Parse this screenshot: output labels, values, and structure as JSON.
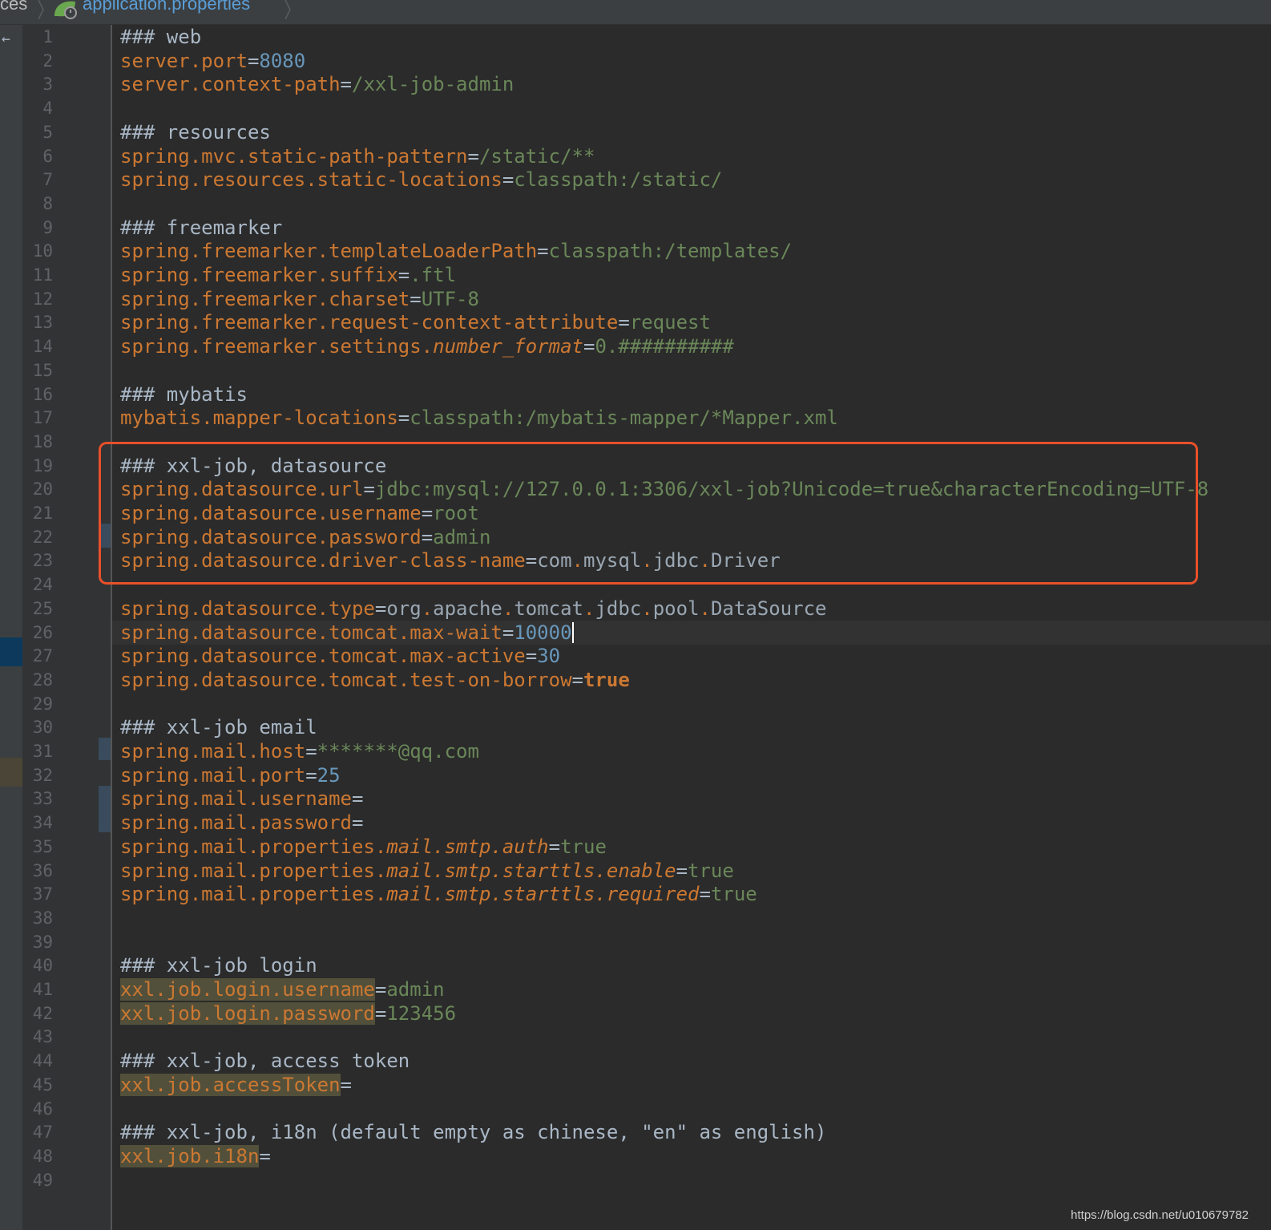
{
  "breadcrumb": {
    "parent": "ces",
    "file": "application.properties",
    "file_color": "#5a9ed8"
  },
  "editor": {
    "line_count": 49,
    "caret_line": 26,
    "highlight_box_color": "#e8502a",
    "lines": [
      [
        {
          "t": "### web",
          "c": "cmt"
        }
      ],
      [
        {
          "t": "server.port",
          "c": "key"
        },
        {
          "t": "=",
          "c": "eq"
        },
        {
          "t": "8080",
          "c": "num"
        }
      ],
      [
        {
          "t": "server.context-path",
          "c": "key"
        },
        {
          "t": "=",
          "c": "eq"
        },
        {
          "t": "/xxl-job-admin",
          "c": "val"
        }
      ],
      [],
      [
        {
          "t": "### resources",
          "c": "cmt"
        }
      ],
      [
        {
          "t": "spring.mvc.static-path-pattern",
          "c": "key"
        },
        {
          "t": "=",
          "c": "eq"
        },
        {
          "t": "/static/**",
          "c": "val"
        }
      ],
      [
        {
          "t": "spring.resources.static-locations",
          "c": "key"
        },
        {
          "t": "=",
          "c": "eq"
        },
        {
          "t": "classpath:/static/",
          "c": "val"
        }
      ],
      [],
      [
        {
          "t": "### freemarker",
          "c": "cmt"
        }
      ],
      [
        {
          "t": "spring.freemarker.templateLoaderPath",
          "c": "key"
        },
        {
          "t": "=",
          "c": "eq"
        },
        {
          "t": "classpath:/templates/",
          "c": "val"
        }
      ],
      [
        {
          "t": "spring.freemarker.suffix",
          "c": "key"
        },
        {
          "t": "=",
          "c": "eq"
        },
        {
          "t": ".ftl",
          "c": "val"
        }
      ],
      [
        {
          "t": "spring.freemarker.charset",
          "c": "key"
        },
        {
          "t": "=",
          "c": "eq"
        },
        {
          "t": "UTF-8",
          "c": "val"
        }
      ],
      [
        {
          "t": "spring.freemarker.request-context-attribute",
          "c": "key"
        },
        {
          "t": "=",
          "c": "eq"
        },
        {
          "t": "request",
          "c": "val"
        }
      ],
      [
        {
          "t": "spring.freemarker.settings.",
          "c": "key"
        },
        {
          "t": "number_format",
          "c": "it"
        },
        {
          "t": "=",
          "c": "eq"
        },
        {
          "t": "0.##########",
          "c": "val"
        }
      ],
      [],
      [
        {
          "t": "### mybatis",
          "c": "cmt"
        }
      ],
      [
        {
          "t": "mybatis.mapper-locations",
          "c": "key"
        },
        {
          "t": "=",
          "c": "eq"
        },
        {
          "t": "classpath:/mybatis-mapper/*Mapper.xml",
          "c": "val"
        }
      ],
      [],
      [
        {
          "t": "### xxl-job, datasource",
          "c": "cmt"
        }
      ],
      [
        {
          "t": "spring.datasource.url",
          "c": "key"
        },
        {
          "t": "=",
          "c": "eq"
        },
        {
          "t": "jdbc:mysql://127.0.0.1:3306/xxl-job?Unicode=true&characterEncoding=UTF-8",
          "c": "val"
        }
      ],
      [
        {
          "t": "spring.datasource.username",
          "c": "key"
        },
        {
          "t": "=",
          "c": "eq"
        },
        {
          "t": "root",
          "c": "val"
        }
      ],
      [
        {
          "t": "spring.datasource.password",
          "c": "key"
        },
        {
          "t": "=",
          "c": "eq"
        },
        {
          "t": "admin",
          "c": "val"
        }
      ],
      [
        {
          "t": "spring.datasource.driver-class-name",
          "c": "key"
        },
        {
          "t": "=",
          "c": "eq"
        },
        {
          "t": "com",
          "c": "cls"
        },
        {
          "t": ".",
          "c": "key"
        },
        {
          "t": "mysql",
          "c": "cls"
        },
        {
          "t": ".",
          "c": "key"
        },
        {
          "t": "jdbc",
          "c": "cls"
        },
        {
          "t": ".",
          "c": "key"
        },
        {
          "t": "Driver",
          "c": "cls"
        }
      ],
      [],
      [
        {
          "t": "spring.datasource.type",
          "c": "key"
        },
        {
          "t": "=",
          "c": "eq"
        },
        {
          "t": "org",
          "c": "cls"
        },
        {
          "t": ".",
          "c": "key"
        },
        {
          "t": "apache",
          "c": "cls"
        },
        {
          "t": ".",
          "c": "key"
        },
        {
          "t": "tomcat",
          "c": "cls"
        },
        {
          "t": ".",
          "c": "key"
        },
        {
          "t": "jdbc",
          "c": "cls"
        },
        {
          "t": ".",
          "c": "key"
        },
        {
          "t": "pool",
          "c": "cls"
        },
        {
          "t": ".",
          "c": "key"
        },
        {
          "t": "DataSource",
          "c": "cls"
        }
      ],
      [
        {
          "t": "spring.datasource.tomcat.max-wait",
          "c": "key"
        },
        {
          "t": "=",
          "c": "eq"
        },
        {
          "t": "10000",
          "c": "num"
        }
      ],
      [
        {
          "t": "spring.datasource.tomcat.max-active",
          "c": "key"
        },
        {
          "t": "=",
          "c": "eq"
        },
        {
          "t": "30",
          "c": "num"
        }
      ],
      [
        {
          "t": "spring.datasource.tomcat.test-on-borrow",
          "c": "key"
        },
        {
          "t": "=",
          "c": "eq"
        },
        {
          "t": "true",
          "c": "kw"
        }
      ],
      [],
      [
        {
          "t": "### xxl-job email",
          "c": "cmt"
        }
      ],
      [
        {
          "t": "spring.mail.host",
          "c": "key"
        },
        {
          "t": "=",
          "c": "eq"
        },
        {
          "t": "*******@qq.com",
          "c": "val"
        }
      ],
      [
        {
          "t": "spring.mail.port",
          "c": "key"
        },
        {
          "t": "=",
          "c": "eq"
        },
        {
          "t": "25",
          "c": "num"
        }
      ],
      [
        {
          "t": "spring.mail.username",
          "c": "key"
        },
        {
          "t": "=",
          "c": "eq"
        }
      ],
      [
        {
          "t": "spring.mail.password",
          "c": "key"
        },
        {
          "t": "=",
          "c": "eq"
        }
      ],
      [
        {
          "t": "spring.mail.properties.",
          "c": "key"
        },
        {
          "t": "mail.smtp.auth",
          "c": "it"
        },
        {
          "t": "=",
          "c": "eq"
        },
        {
          "t": "true",
          "c": "val"
        }
      ],
      [
        {
          "t": "spring.mail.properties.",
          "c": "key"
        },
        {
          "t": "mail.smtp.starttls.enable",
          "c": "it"
        },
        {
          "t": "=",
          "c": "eq"
        },
        {
          "t": "true",
          "c": "val"
        }
      ],
      [
        {
          "t": "spring.mail.properties.",
          "c": "key"
        },
        {
          "t": "mail.smtp.starttls.required",
          "c": "it"
        },
        {
          "t": "=",
          "c": "eq"
        },
        {
          "t": "true",
          "c": "val"
        }
      ],
      [],
      [],
      [
        {
          "t": "### xxl-job login",
          "c": "cmt"
        }
      ],
      [
        {
          "t": "xxl.job.login.username",
          "c": "hl"
        },
        {
          "t": "=",
          "c": "eq"
        },
        {
          "t": "admin",
          "c": "val"
        }
      ],
      [
        {
          "t": "xxl.job.login.password",
          "c": "hl"
        },
        {
          "t": "=",
          "c": "eq"
        },
        {
          "t": "123456",
          "c": "val"
        }
      ],
      [],
      [
        {
          "t": "### xxl-job, access token",
          "c": "cmt"
        }
      ],
      [
        {
          "t": "xxl.job.accessToken",
          "c": "hl"
        },
        {
          "t": "=",
          "c": "eq"
        }
      ],
      [],
      [
        {
          "t": "### xxl-job, i18n (default empty as chinese, \"en\" as english)",
          "c": "cmt"
        }
      ],
      [
        {
          "t": "xxl.job.i18n",
          "c": "hl"
        },
        {
          "t": "=",
          "c": "eq"
        }
      ],
      []
    ]
  },
  "watermark": "https://blog.csdn.net/u010679782"
}
